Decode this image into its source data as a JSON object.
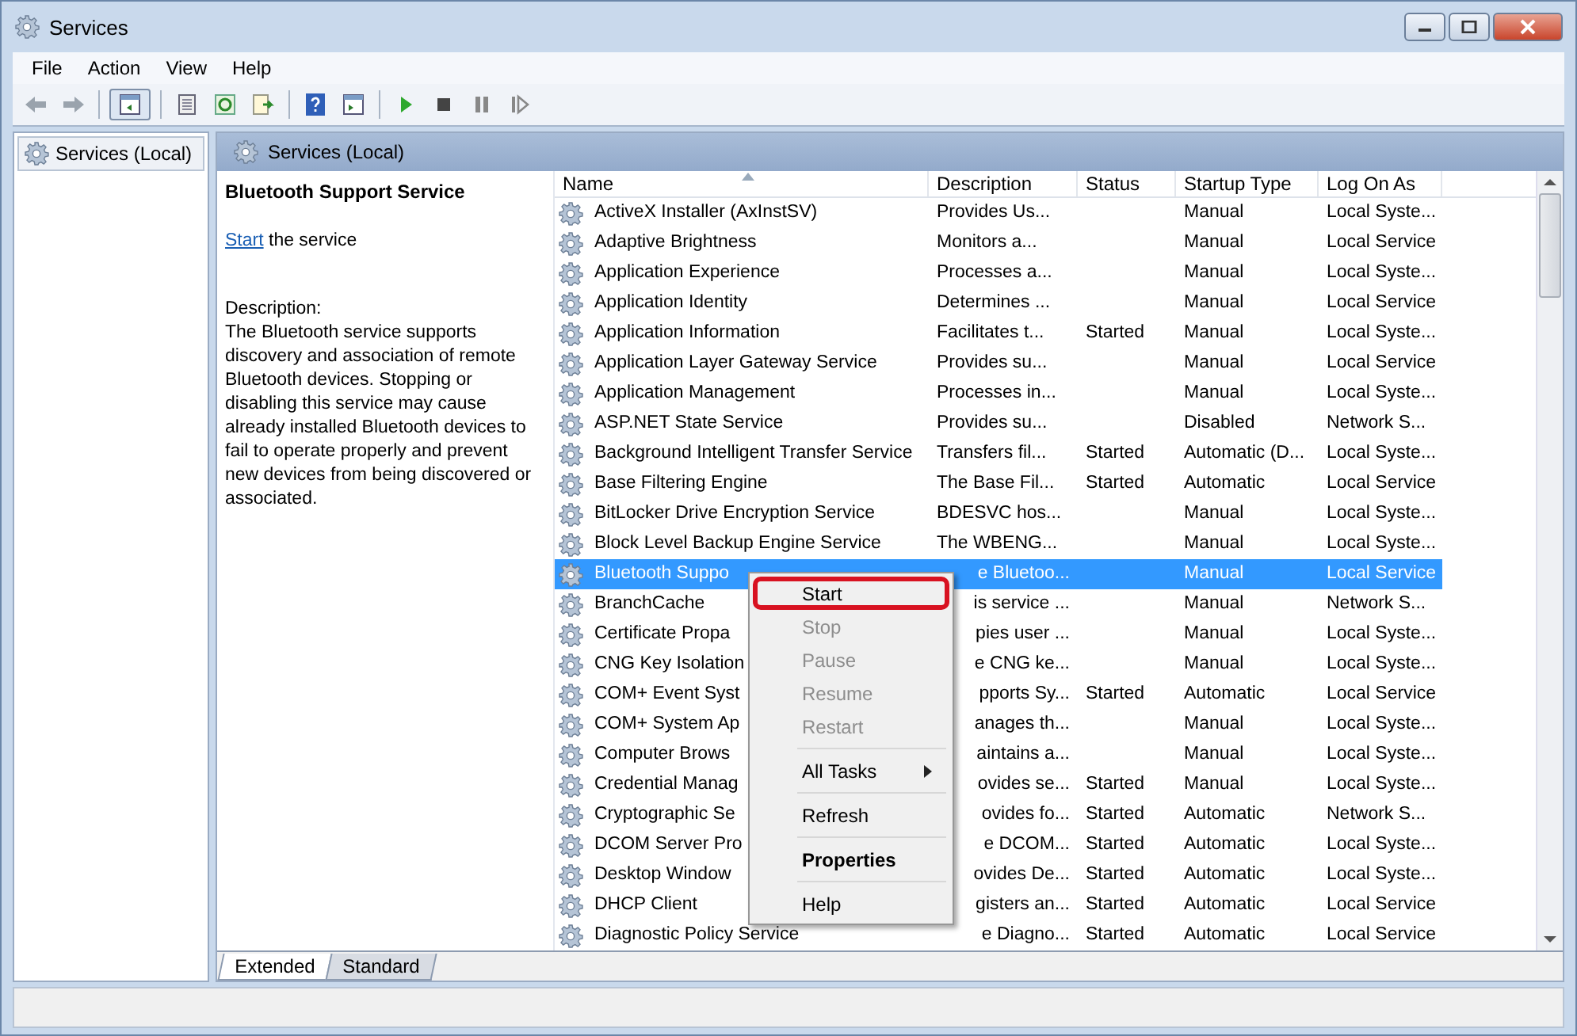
{
  "window": {
    "title": "Services"
  },
  "menu_bar": [
    "File",
    "Action",
    "View",
    "Help"
  ],
  "tree": {
    "items": [
      {
        "label": "Services (Local)",
        "selected": true
      }
    ]
  },
  "pane": {
    "title": "Services (Local)"
  },
  "details": {
    "service_name": "Bluetooth Support Service",
    "action_link": "Start",
    "action_text": "the service",
    "description_label": "Description:",
    "description": "The Bluetooth service supports discovery and association of remote Bluetooth devices.  Stopping or disabling this service may cause already installed Bluetooth devices to fail to operate properly and prevent new devices from being discovered or associated."
  },
  "table": {
    "columns": [
      {
        "label": "Name",
        "sorted": true
      },
      {
        "label": "Description",
        "sorted": false
      },
      {
        "label": "Status",
        "sorted": false
      },
      {
        "label": "Startup Type",
        "sorted": false
      },
      {
        "label": "Log On As",
        "sorted": false
      }
    ],
    "rows": [
      {
        "name": "ActiveX Installer (AxInstSV)",
        "description": "Provides Us...",
        "startup_type": "Manual",
        "log_on_as": "Local Syste...",
        "selected": false
      },
      {
        "name": "Adaptive Brightness",
        "description": "Monitors a...",
        "startup_type": "Manual",
        "log_on_as": "Local Service",
        "selected": false
      },
      {
        "name": "Application Experience",
        "description": "Processes a...",
        "startup_type": "Manual",
        "log_on_as": "Local Syste...",
        "selected": false
      },
      {
        "name": "Application Identity",
        "description": "Determines ...",
        "startup_type": "Manual",
        "log_on_as": "Local Service",
        "selected": false
      },
      {
        "name": "Application Information",
        "description": "Facilitates t...",
        "status": "Started",
        "startup_type": "Manual",
        "log_on_as": "Local Syste...",
        "selected": false
      },
      {
        "name": "Application Layer Gateway Service",
        "description": "Provides su...",
        "startup_type": "Manual",
        "log_on_as": "Local Service",
        "selected": false
      },
      {
        "name": "Application Management",
        "description": "Processes in...",
        "startup_type": "Manual",
        "log_on_as": "Local Syste...",
        "selected": false
      },
      {
        "name": "ASP.NET State Service",
        "description": "Provides su...",
        "startup_type": "Disabled",
        "log_on_as": "Network S...",
        "selected": false
      },
      {
        "name": "Background Intelligent Transfer Service",
        "description": "Transfers fil...",
        "status": "Started",
        "startup_type": "Automatic (D...",
        "log_on_as": "Local Syste...",
        "selected": false
      },
      {
        "name": "Base Filtering Engine",
        "description": "The Base Fil...",
        "status": "Started",
        "startup_type": "Automatic",
        "log_on_as": "Local Service",
        "selected": false
      },
      {
        "name": "BitLocker Drive Encryption Service",
        "description": "BDESVC hos...",
        "startup_type": "Manual",
        "log_on_as": "Local Syste...",
        "selected": false
      },
      {
        "name": "Block Level Backup Engine Service",
        "description": "The WBENG...",
        "startup_type": "Manual",
        "log_on_as": "Local Syste...",
        "selected": false
      },
      {
        "name": "Bluetooth Suppo",
        "description": "e Bluetoo...",
        "startup_type": "Manual",
        "log_on_as": "Local Service",
        "selected": true
      },
      {
        "name": "BranchCache",
        "description": "is service ...",
        "startup_type": "Manual",
        "log_on_as": "Network S...",
        "selected": false
      },
      {
        "name": "Certificate Propa",
        "description": "pies user ...",
        "startup_type": "Manual",
        "log_on_as": "Local Syste...",
        "selected": false
      },
      {
        "name": "CNG Key Isolation",
        "description": "e CNG ke...",
        "startup_type": "Manual",
        "log_on_as": "Local Syste...",
        "selected": false
      },
      {
        "name": "COM+ Event Syst",
        "description": "pports Sy...",
        "status": "Started",
        "startup_type": "Automatic",
        "log_on_as": "Local Service",
        "selected": false
      },
      {
        "name": "COM+ System Ap",
        "description": "anages th...",
        "startup_type": "Manual",
        "log_on_as": "Local Syste...",
        "selected": false
      },
      {
        "name": "Computer Brows",
        "description": "aintains a...",
        "startup_type": "Manual",
        "log_on_as": "Local Syste...",
        "selected": false
      },
      {
        "name": "Credential Manag",
        "description": "ovides se...",
        "status": "Started",
        "startup_type": "Manual",
        "log_on_as": "Local Syste...",
        "selected": false
      },
      {
        "name": "Cryptographic Se",
        "description": "ovides fo...",
        "status": "Started",
        "startup_type": "Automatic",
        "log_on_as": "Network S...",
        "selected": false
      },
      {
        "name": "DCOM Server Pro",
        "description": "e DCOM...",
        "status": "Started",
        "startup_type": "Automatic",
        "log_on_as": "Local Syste...",
        "selected": false
      },
      {
        "name": "Desktop Window",
        "description": "ovides De...",
        "status": "Started",
        "startup_type": "Automatic",
        "log_on_as": "Local Syste...",
        "selected": false
      },
      {
        "name": "DHCP Client",
        "description": "gisters an...",
        "status": "Started",
        "startup_type": "Automatic",
        "log_on_as": "Local Service",
        "selected": false
      },
      {
        "name": "Diagnostic Policy Service",
        "description": "e Diagno...",
        "status": "Started",
        "startup_type": "Automatic",
        "log_on_as": "Local Service",
        "selected": false
      }
    ]
  },
  "context_menu": {
    "items": [
      {
        "kind": "item",
        "label": "Start",
        "disabled": false,
        "highlighted": true,
        "default": false
      },
      {
        "kind": "item",
        "label": "Stop",
        "disabled": true,
        "highlighted": false,
        "default": false
      },
      {
        "kind": "item",
        "label": "Pause",
        "disabled": true,
        "highlighted": false,
        "default": false
      },
      {
        "kind": "item",
        "label": "Resume",
        "disabled": true,
        "highlighted": false,
        "default": false
      },
      {
        "kind": "item",
        "label": "Restart",
        "disabled": true,
        "highlighted": false,
        "default": false
      },
      {
        "kind": "separator"
      },
      {
        "kind": "submenu",
        "label": "All Tasks",
        "disabled": false,
        "highlighted": false,
        "default": false
      },
      {
        "kind": "separator"
      },
      {
        "kind": "item",
        "label": "Refresh",
        "disabled": false,
        "highlighted": false,
        "default": false
      },
      {
        "kind": "separator"
      },
      {
        "kind": "item",
        "label": "Properties",
        "disabled": false,
        "highlighted": false,
        "default": true
      },
      {
        "kind": "separator"
      },
      {
        "kind": "item",
        "label": "Help",
        "disabled": false,
        "highlighted": false,
        "default": false
      }
    ]
  },
  "tabs": [
    {
      "label": "Extended",
      "selected": true
    },
    {
      "label": "Standard",
      "selected": false
    }
  ]
}
